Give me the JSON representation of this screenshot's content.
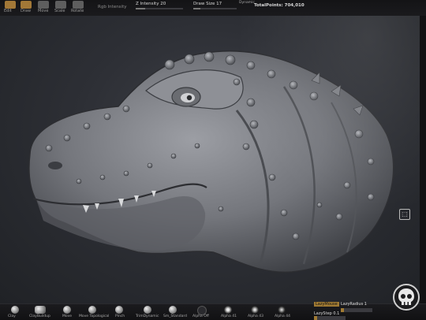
{
  "toolbar": {
    "tools": [
      {
        "label": "Edit",
        "icon": "edit-icon"
      },
      {
        "label": "Draw",
        "icon": "draw-icon"
      },
      {
        "label": "Move",
        "icon": "move-icon"
      },
      {
        "label": "Scale",
        "icon": "scale-icon"
      },
      {
        "label": "Rotate",
        "icon": "rotate-icon"
      }
    ],
    "rgb_intensity_label": "Rgb Intensity",
    "z_intensity": "Z Intensity 20",
    "draw_size": "Draw Size 17",
    "dynamic_label": "Dynamic",
    "total_points": "TotalPoints: 704,010",
    "z_intensity_level": 0.2,
    "draw_size_level": 0.17,
    "accent_color": "#bb8a3d"
  },
  "viewport": {
    "model_description": "sculpted dinosaur head mesh",
    "background_color": "#2d2f35",
    "nav_icon": "frame-icon"
  },
  "brushes": [
    {
      "label": "Clay"
    },
    {
      "label": "ClayBuildup"
    },
    {
      "label": "Move"
    },
    {
      "label": "Move Topological"
    },
    {
      "label": "Pinch"
    },
    {
      "label": "TrimDynamic"
    },
    {
      "label": "Sm_Standard"
    },
    {
      "label": "Alpha Off"
    },
    {
      "label": "Alpha 41"
    },
    {
      "label": "Alpha 43"
    },
    {
      "label": "Alpha 44"
    }
  ],
  "lazy": {
    "mouse_label": "LazyMouse",
    "radius_label": "LazyRadius 1",
    "step_label": "LazyStep 0.1",
    "step_level": 0.1
  },
  "logo": {
    "icon": "skull-logo-icon"
  }
}
